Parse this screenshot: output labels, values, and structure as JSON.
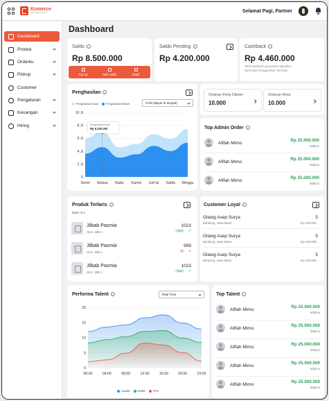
{
  "header": {
    "brand": "Komerce",
    "brand_tagline": "hadir untuk indonesia",
    "greeting": "Selamat Pagi, Partner"
  },
  "sidebar": {
    "items": [
      {
        "label": "Dashboard",
        "active": true,
        "has_submenu": false
      },
      {
        "label": "Produk",
        "active": false,
        "has_submenu": true
      },
      {
        "label": "Orderku",
        "active": false,
        "has_submenu": true
      },
      {
        "label": "Pickup",
        "active": false,
        "has_submenu": true
      },
      {
        "label": "Customer",
        "active": false,
        "has_submenu": false
      },
      {
        "label": "Pengaturan",
        "active": false,
        "has_submenu": true
      },
      {
        "label": "Keuangan",
        "active": false,
        "has_submenu": true
      },
      {
        "label": "Hiring",
        "active": false,
        "has_submenu": true
      }
    ]
  },
  "page_title": "Dashboard",
  "saldo": {
    "title": "Saldo",
    "value": "Rp 8.500.000",
    "actions": [
      "Top Up",
      "Tarik Saldo",
      "Detail"
    ]
  },
  "saldo_pending": {
    "title": "Saldo Pending",
    "value": "Rp 4.200.000"
  },
  "cashback": {
    "title": "Cashback",
    "value": "Rp 4.460.000",
    "note_line1": "Total cashback yang kamu dapatkan",
    "note_line2": "semenjak menggunakan komship"
  },
  "penghasilan": {
    "title": "Penghasilan",
    "filter": "COD (Bayar di tempat)",
    "tooltip_label": "Penghasilan Kotor",
    "tooltip_value": "Rp 6.200.000"
  },
  "chart_data": [
    {
      "type": "area",
      "title": "Penghasilan",
      "categories": [
        "Senin",
        "Selasa",
        "Rabu",
        "Kamis",
        "Jum'at",
        "Sabtu",
        "Minggu"
      ],
      "y_ticks": [
        "0",
        "2 Jt",
        "4 Jt",
        "6 Jt",
        "8 Jt",
        "10 Jt"
      ],
      "ylim": [
        0,
        10
      ],
      "series": [
        {
          "name": "Penghasilan Kotor",
          "color": "#bfe3fb",
          "values": [
            6.0,
            6.9,
            4.6,
            5.1,
            6.6,
            5.9,
            7.4
          ]
        },
        {
          "name": "Penghasilan Bersih",
          "color": "#2d8ff0",
          "values": [
            3.6,
            4.6,
            3.0,
            3.5,
            4.8,
            4.0,
            5.3
          ]
        }
      ],
      "legend": "top-left"
    },
    {
      "type": "area",
      "title": "Performa Talent",
      "categories": [
        "00:00",
        "04:00",
        "08:00",
        "12:00",
        "16:00",
        "20:00",
        "23:59"
      ],
      "y_ticks": [
        "0",
        "5",
        "10",
        "15",
        "20"
      ],
      "ylim": [
        0,
        20
      ],
      "series": [
        {
          "name": "Leads",
          "color": "#3b8ff0",
          "values": [
            12.0,
            13.5,
            14.2,
            16.5,
            17.5,
            14.8,
            12.8
          ]
        },
        {
          "name": "Order",
          "color": "#2fae5c",
          "values": [
            8.2,
            9.3,
            10.3,
            12.0,
            12.3,
            9.8,
            8.4
          ]
        },
        {
          "name": "Pcs",
          "color": "#ef5a4c",
          "values": [
            2.0,
            2.6,
            4.8,
            8.2,
            7.5,
            5.0,
            2.2
          ]
        }
      ],
      "legend": "bottom"
    }
  ],
  "orders": {
    "perlu_dikirim": {
      "label": "Orderan Perlu Dikirim",
      "value": "10.000"
    },
    "retur": {
      "label": "Orderan Retur",
      "value": "10.000"
    }
  },
  "top_admin": {
    "title": "Top Admin Order",
    "rows": [
      {
        "name": "Afifah Mimo",
        "amount": "Rp 25.000.000",
        "sub": "500pcs"
      },
      {
        "name": "Afifah Mimo",
        "amount": "Rp 25.000.000",
        "sub": "500pcs"
      },
      {
        "name": "Afifah Mimo",
        "amount": "Rp 25.000.000",
        "sub": "500pcs"
      }
    ]
  },
  "produk_terlaris": {
    "title": "Produk Terlaris",
    "period": "Bulan ini",
    "rows": [
      {
        "name": "Jilbab Pasmia",
        "sku": "SKU: JBB-1",
        "value": "1023",
        "change": "+30%",
        "trend": "up"
      },
      {
        "name": "Jilbab Pasmia",
        "sku": "SKU: JBB-1",
        "value": "999",
        "change": "-5",
        "trend": "down"
      },
      {
        "name": "Jilbab Pasmia",
        "sku": "SKU: JBB-1",
        "value": "1023",
        "change": "+30%",
        "trend": "up"
      }
    ]
  },
  "customer_loyal": {
    "title": "Customer Loyal",
    "rows": [
      {
        "name": "Gilang Asep Surya",
        "address": "Bandung, Jawa Barat",
        "qty": "5",
        "total": "Rp 440.000,-"
      },
      {
        "name": "Gilang Asep Surya",
        "address": "Bandung, Jawa Barat",
        "qty": "5",
        "total": "Rp 440.000,-"
      },
      {
        "name": "Gilang Asep Surya",
        "address": "Bandung, Jawa Barat",
        "qty": "5",
        "total": "Rp 440.000,-"
      }
    ]
  },
  "performa": {
    "title": "Performa Talent",
    "filter": "Real Time"
  },
  "top_talent": {
    "title": "Top Talent",
    "rows": [
      {
        "name": "Afifah Mimo",
        "amount": "Rp 25.000.000",
        "sub": "500pcs"
      },
      {
        "name": "Afifah Mimo",
        "amount": "Rp 25.000.000",
        "sub": "500pcs"
      },
      {
        "name": "Afifah Mimo",
        "amount": "Rp 25.000.000",
        "sub": "500pcs"
      },
      {
        "name": "Afifah Mimo",
        "amount": "Rp 25.000.000",
        "sub": "500pcs"
      },
      {
        "name": "Afifah Mimo",
        "amount": "Rp 25.000.000",
        "sub": "500pcs"
      }
    ]
  }
}
